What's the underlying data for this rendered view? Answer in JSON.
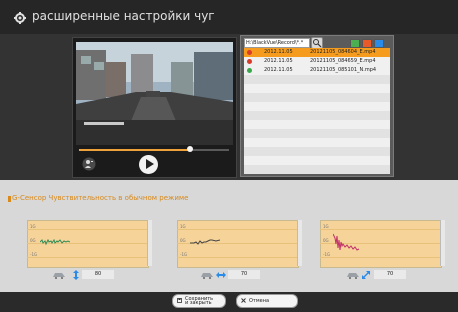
{
  "window": {
    "title": "расширенные настройки чуг"
  },
  "file_panel": {
    "path_value": "H:\\BlackVue\\Record\\*.*",
    "filter_buttons": [
      {
        "icon": "filter-normal-icon",
        "color": "#4caf50"
      },
      {
        "icon": "filter-event-icon",
        "color": "#e85a2a"
      },
      {
        "icon": "filter-parking-icon",
        "color": "#2a8be8"
      }
    ],
    "rows": [
      {
        "date": "2012.11.05",
        "name": "20121105_084604_E.mp4",
        "icon": "event-file-icon",
        "selected": true
      },
      {
        "date": "2012.11.05",
        "name": "20121105_084659_E.mp4",
        "icon": "event-file-icon",
        "selected": false
      },
      {
        "date": "2012.11.05",
        "name": "20121105_085101_N.mp4",
        "icon": "normal-file-icon",
        "selected": false
      }
    ]
  },
  "player": {
    "progress_fraction": 0.74,
    "play_icon": "play-icon",
    "user_icon": "user-icon"
  },
  "gsensor": {
    "title": "G-Сенсор Чувствительность в обычном режиме",
    "axis_top": "1G",
    "axis_mid": "0G",
    "axis_bot": "-1G",
    "charts": [
      {
        "axis": "vertical",
        "value": "80",
        "color": "#2e8b57"
      },
      {
        "axis": "horizontal",
        "value": "70",
        "color": "#444444"
      },
      {
        "axis": "diagonal",
        "value": "70",
        "color": "#c0306a"
      }
    ]
  },
  "buttons": {
    "save": "Сохранить\nи закрыть",
    "cancel": "Отмена"
  }
}
